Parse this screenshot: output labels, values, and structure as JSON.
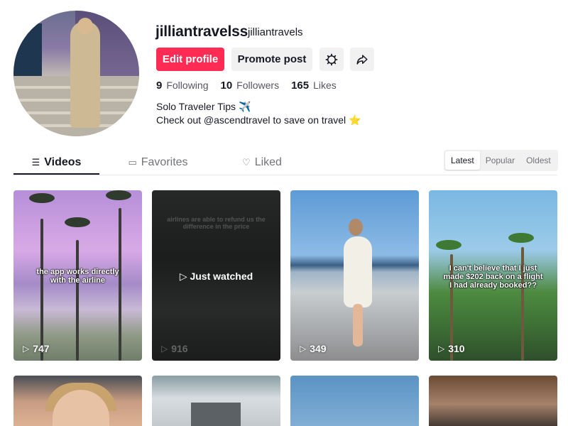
{
  "profile": {
    "username": "jilliantravelss",
    "nickname": "jilliantravels",
    "edit_label": "Edit profile",
    "promote_label": "Promote post",
    "stats": [
      {
        "value": "9",
        "label": "Following"
      },
      {
        "value": "10",
        "label": "Followers"
      },
      {
        "value": "165",
        "label": "Likes"
      }
    ],
    "bio_line1": "Solo Traveler Tips ✈️",
    "bio_line2": "Check out @ascendtravel to save on travel ⭐"
  },
  "tabs": [
    {
      "label": "Videos",
      "icon": "grid-icon"
    },
    {
      "label": "Favorites",
      "icon": "bookmark-icon"
    },
    {
      "label": "Liked",
      "icon": "heart-icon"
    }
  ],
  "sort": {
    "options": [
      "Latest",
      "Popular",
      "Oldest"
    ],
    "selected": "Latest"
  },
  "videos": [
    {
      "caption": "the app works directly with the airline",
      "views": "747"
    },
    {
      "caption": "airlines are able to refund us the difference in the price",
      "overlay": "Just watched",
      "views": "916"
    },
    {
      "caption": "",
      "views": "349"
    },
    {
      "caption": "I can't believe that I just made $202 back on a flight I had already booked??",
      "views": "310"
    },
    {
      "caption": "",
      "views": ""
    },
    {
      "caption": "",
      "views": ""
    },
    {
      "caption": "",
      "views": ""
    },
    {
      "caption": "",
      "views": ""
    }
  ],
  "colors": {
    "accent": "#fe2c55",
    "button_gray": "#f1f1f2",
    "text": "#161823",
    "muted": "#73747b"
  }
}
